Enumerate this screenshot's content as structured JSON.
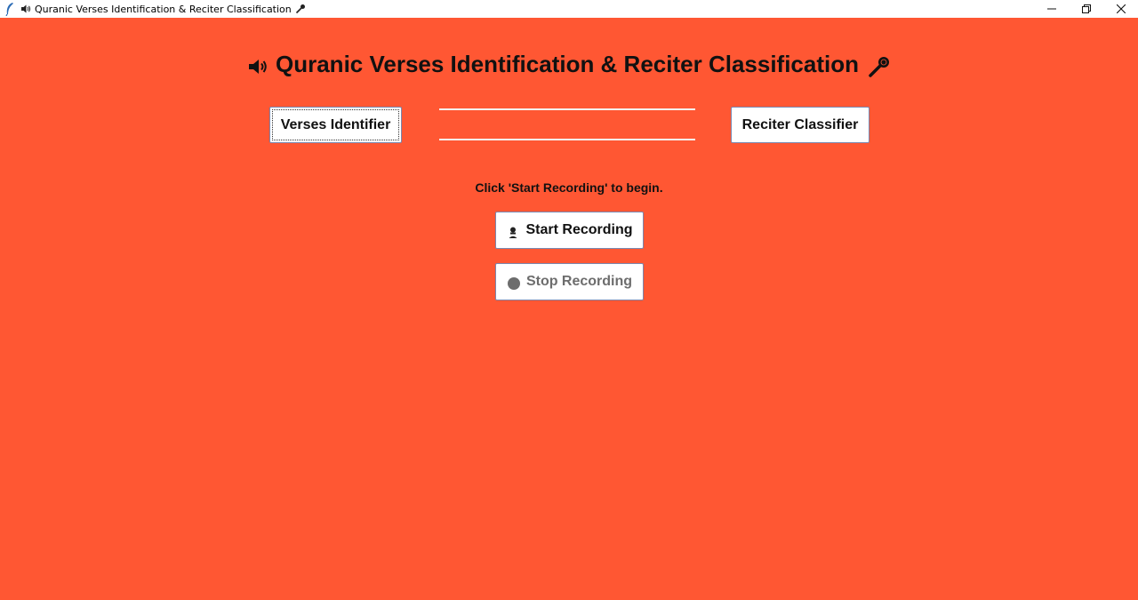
{
  "window": {
    "title": "Quranic Verses Identification & Reciter Classification",
    "background_color": "#ff5733",
    "controls": {
      "minimize_icon": "minimize-icon",
      "maximize_icon": "maximize-icon",
      "close_icon": "close-icon"
    }
  },
  "header": {
    "title": "Quranic Verses Identification & Reciter Classification",
    "left_icon": "speaker-icon",
    "right_icon": "microphone-icon"
  },
  "tabs": {
    "verses_label": "Verses Identifier",
    "reciter_label": "Reciter Classifier"
  },
  "status": {
    "text": "Click 'Start Recording' to begin."
  },
  "controls": {
    "start_label": "Start Recording",
    "start_icon": "person-mic-icon",
    "stop_label": "Stop Recording",
    "stop_icon": "stop-circle-icon",
    "stop_enabled": false
  }
}
